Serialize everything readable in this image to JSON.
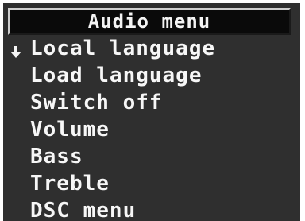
{
  "menu": {
    "title": "Audio menu",
    "selected_index": 0,
    "cursor_icon": "arrow-cursor-icon",
    "items": [
      {
        "label": "Local language"
      },
      {
        "label": "Load language"
      },
      {
        "label": "Switch off"
      },
      {
        "label": "Volume"
      },
      {
        "label": "Bass"
      },
      {
        "label": "Treble"
      },
      {
        "label": "DSC menu"
      }
    ]
  },
  "colors": {
    "background": "#2f2f2f",
    "title_bar": "#0a0a0a",
    "text": "#f7f7f7"
  }
}
